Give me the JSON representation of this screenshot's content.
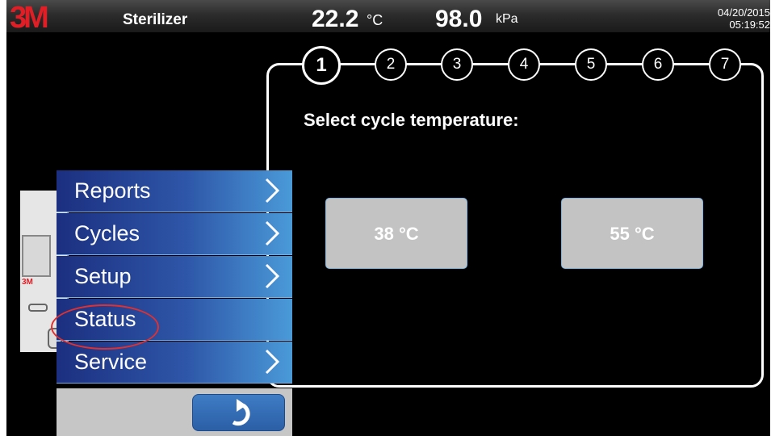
{
  "header": {
    "logo": "3M",
    "title": "Sterilizer",
    "temperature": "22.2",
    "temperature_unit": "°C",
    "pressure": "98.0",
    "pressure_unit": "kPa",
    "date": "04/20/2015",
    "time": "05:19:52"
  },
  "stepper": {
    "steps": [
      "1",
      "2",
      "3",
      "4",
      "5",
      "6",
      "7"
    ],
    "active_step": "1"
  },
  "main": {
    "prompt": "Select cycle temperature:",
    "options": [
      "38 °C",
      "55 °C"
    ]
  },
  "device": {
    "logo": "3M"
  },
  "menu": {
    "items": [
      {
        "label": "Reports",
        "has_chevron": true
      },
      {
        "label": "Cycles",
        "has_chevron": true
      },
      {
        "label": "Setup",
        "has_chevron": true
      },
      {
        "label": "Status",
        "has_chevron": false
      },
      {
        "label": "Service",
        "has_chevron": true
      }
    ],
    "back_icon": "back-arrow-icon"
  },
  "colors": {
    "brand_red": "#e01e26",
    "menu_dark": "#1c2f80",
    "menu_light": "#4a9ad8",
    "button_gray": "#c3c3c3",
    "highlight": "#e03030"
  }
}
